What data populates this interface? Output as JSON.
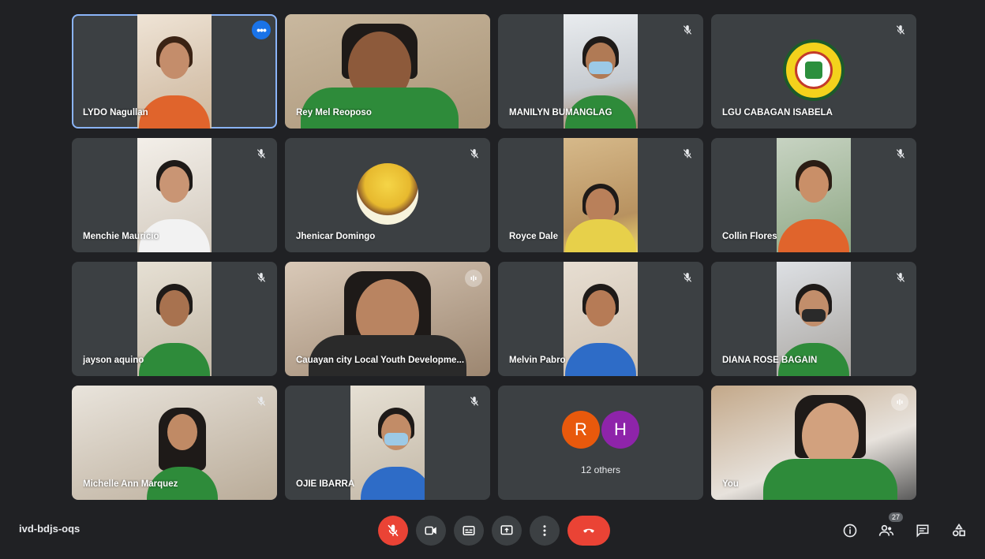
{
  "meeting": {
    "code": "ivd-bdjs-oqs",
    "people_count": "27"
  },
  "tiles": [
    {
      "name": "LYDO Nagullan",
      "mic": "menu"
    },
    {
      "name": "Rey Mel Reoposo",
      "mic": "none"
    },
    {
      "name": "MANILYN BUMANGLAG",
      "mic": "off"
    },
    {
      "name": "LGU CABAGAN ISABELA",
      "mic": "off"
    },
    {
      "name": "Menchie Mauricio",
      "mic": "off"
    },
    {
      "name": "Jhenicar Domingo",
      "mic": "off"
    },
    {
      "name": "Royce Dale",
      "mic": "off"
    },
    {
      "name": "Collin Flores",
      "mic": "off"
    },
    {
      "name": "jayson aquino",
      "mic": "off"
    },
    {
      "name": "Cauayan city Local Youth Developme...",
      "mic": "speaking"
    },
    {
      "name": "Melvin Pabro",
      "mic": "off"
    },
    {
      "name": "DIANA ROSE BAGAIN",
      "mic": "off"
    },
    {
      "name": "Michelle Ann Marquez",
      "mic": "off"
    },
    {
      "name": "OJIE IBARRA",
      "mic": "off"
    },
    {
      "name": "12 others",
      "avatars": [
        "R",
        "H"
      ],
      "avatar_colors": [
        "#e8590c",
        "#8e24aa"
      ]
    },
    {
      "name": "You",
      "mic": "speaking"
    }
  ],
  "colors": {
    "background": "#202124",
    "tile": "#3c4043",
    "accent": "#1a73e8",
    "end_call": "#ea4335"
  }
}
